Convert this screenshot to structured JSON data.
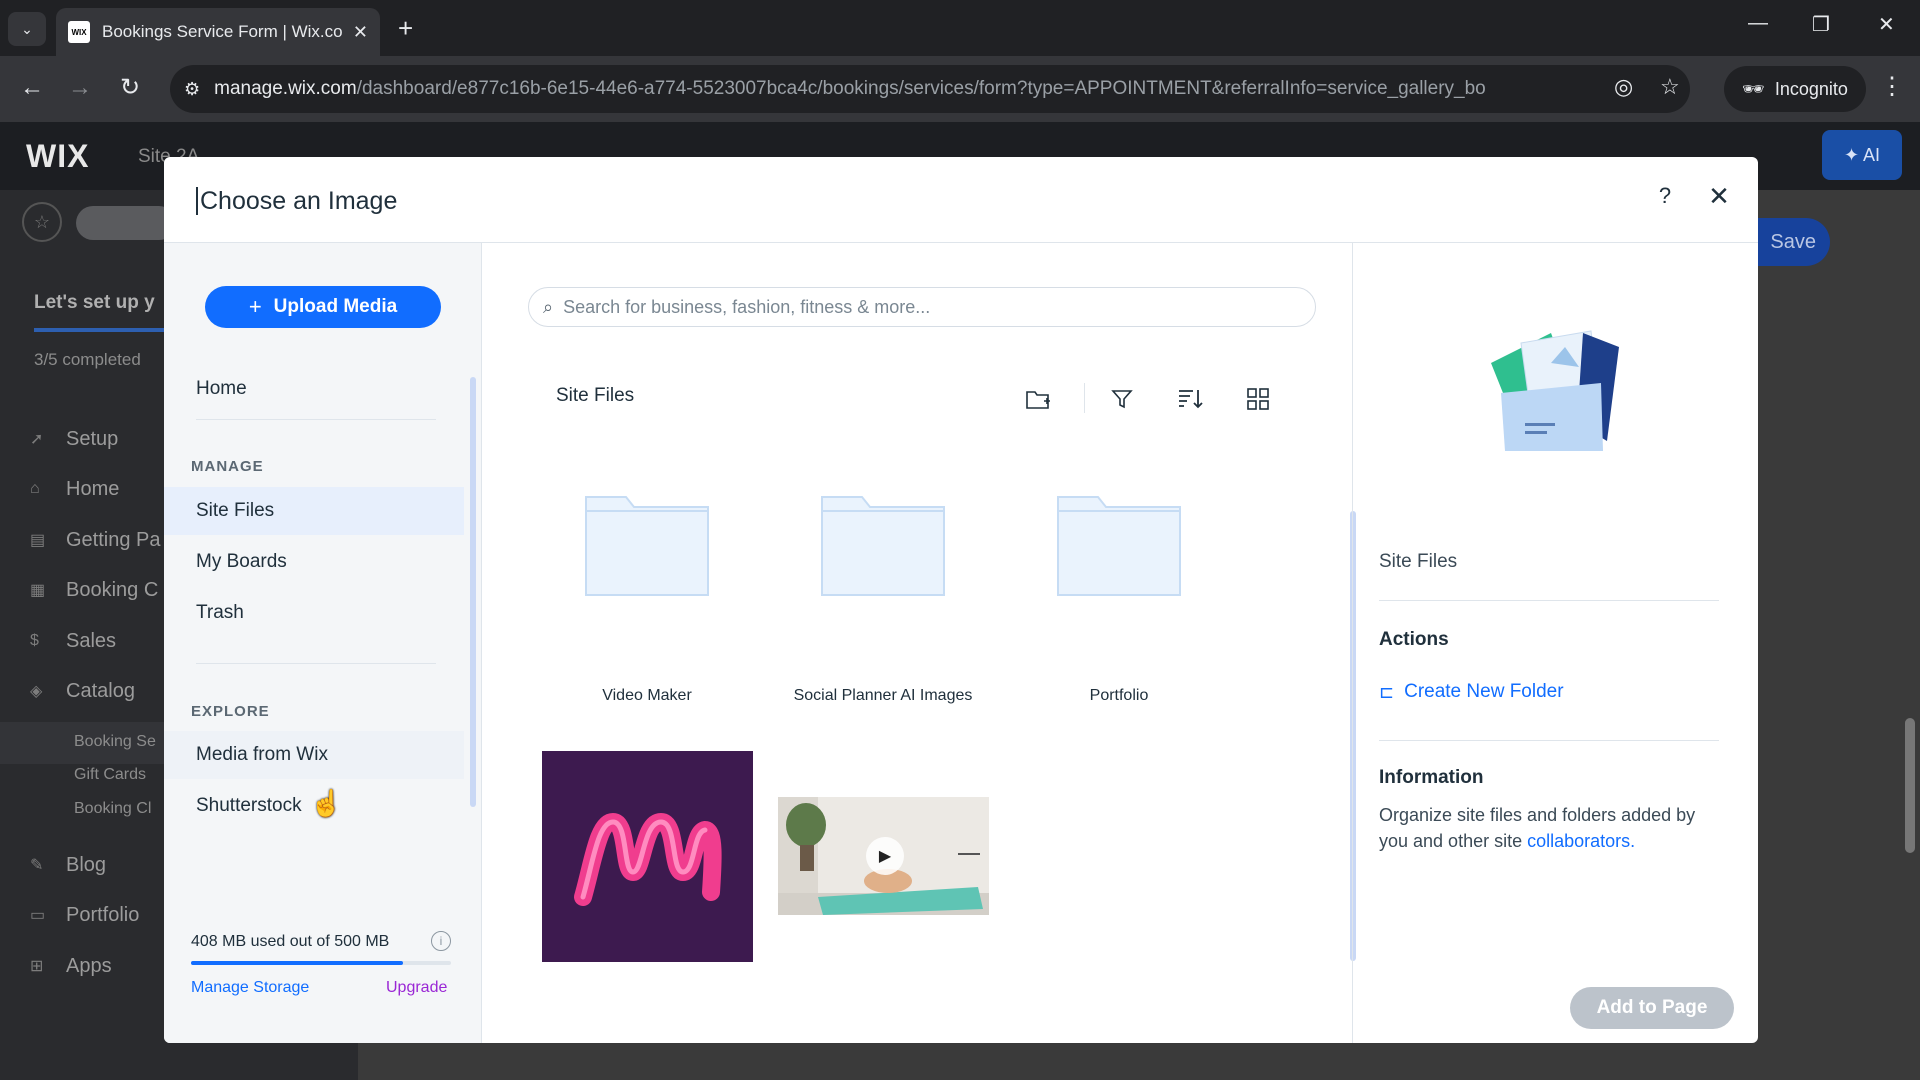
{
  "browser": {
    "tab_title": "Bookings Service Form | Wix.co",
    "favicon_text": "WIX",
    "url_host": "manage.wix.com",
    "url_path": "/dashboard/e877c16b-6e15-44e6-a774-5523007bca4c/bookings/services/form?type=APPOINTMENT&referralInfo=service_gallery_bo",
    "incognito_label": "Incognito"
  },
  "wix": {
    "logo": "WIX",
    "site_label": "Site 2A",
    "ai_label": "✦ AI",
    "save_label": "Save",
    "setup_title": "Let's set up y",
    "setup_progress": "3/5 completed",
    "nav": [
      {
        "label": "Setup",
        "icon": "rocket-icon"
      },
      {
        "label": "Home",
        "icon": "home-icon"
      },
      {
        "label": "Getting Pa",
        "icon": "doc-icon"
      },
      {
        "label": "Booking C",
        "icon": "calendar-icon"
      },
      {
        "label": "Sales",
        "icon": "dollar-icon"
      },
      {
        "label": "Catalog",
        "icon": "tag-icon"
      },
      {
        "label": "Blog",
        "icon": "pen-icon"
      },
      {
        "label": "Portfolio",
        "icon": "briefcase-icon"
      },
      {
        "label": "Apps",
        "icon": "grid-icon"
      }
    ],
    "catalog_sub": [
      "Booking Se",
      "Gift Cards",
      "Booking Cl"
    ]
  },
  "modal": {
    "title": "Choose an Image",
    "help_glyph": "?",
    "close_glyph": "✕",
    "upload_label": "Upload Media",
    "nav_home": "Home",
    "manage_heading": "MANAGE",
    "manage_items": [
      "Site Files",
      "My Boards",
      "Trash"
    ],
    "explore_heading": "EXPLORE",
    "explore_items": [
      "Media from Wix",
      "Shutterstock"
    ],
    "storage_text": "408 MB used out of 500 MB",
    "storage_used_fraction": 0.816,
    "manage_storage": "Manage Storage",
    "upgrade": "Upgrade",
    "search_placeholder": "Search for business, fashion, fitness & more...",
    "breadcrumb": "Site Files",
    "folders": [
      "Video Maker",
      "Social Planner AI Images",
      "Portfolio"
    ],
    "details": {
      "name": "Site Files",
      "actions_heading": "Actions",
      "create_folder": "Create New Folder",
      "info_heading": "Information",
      "info_text": "Organize site files and folders added by you and other site ",
      "info_link": "collaborators."
    },
    "add_to_page": "Add to Page"
  },
  "colors": {
    "accent": "#116dff",
    "upgrade": "#9a27d5",
    "selected_bg": "#e7effc",
    "disabled_btn": "#bcc3cb"
  }
}
